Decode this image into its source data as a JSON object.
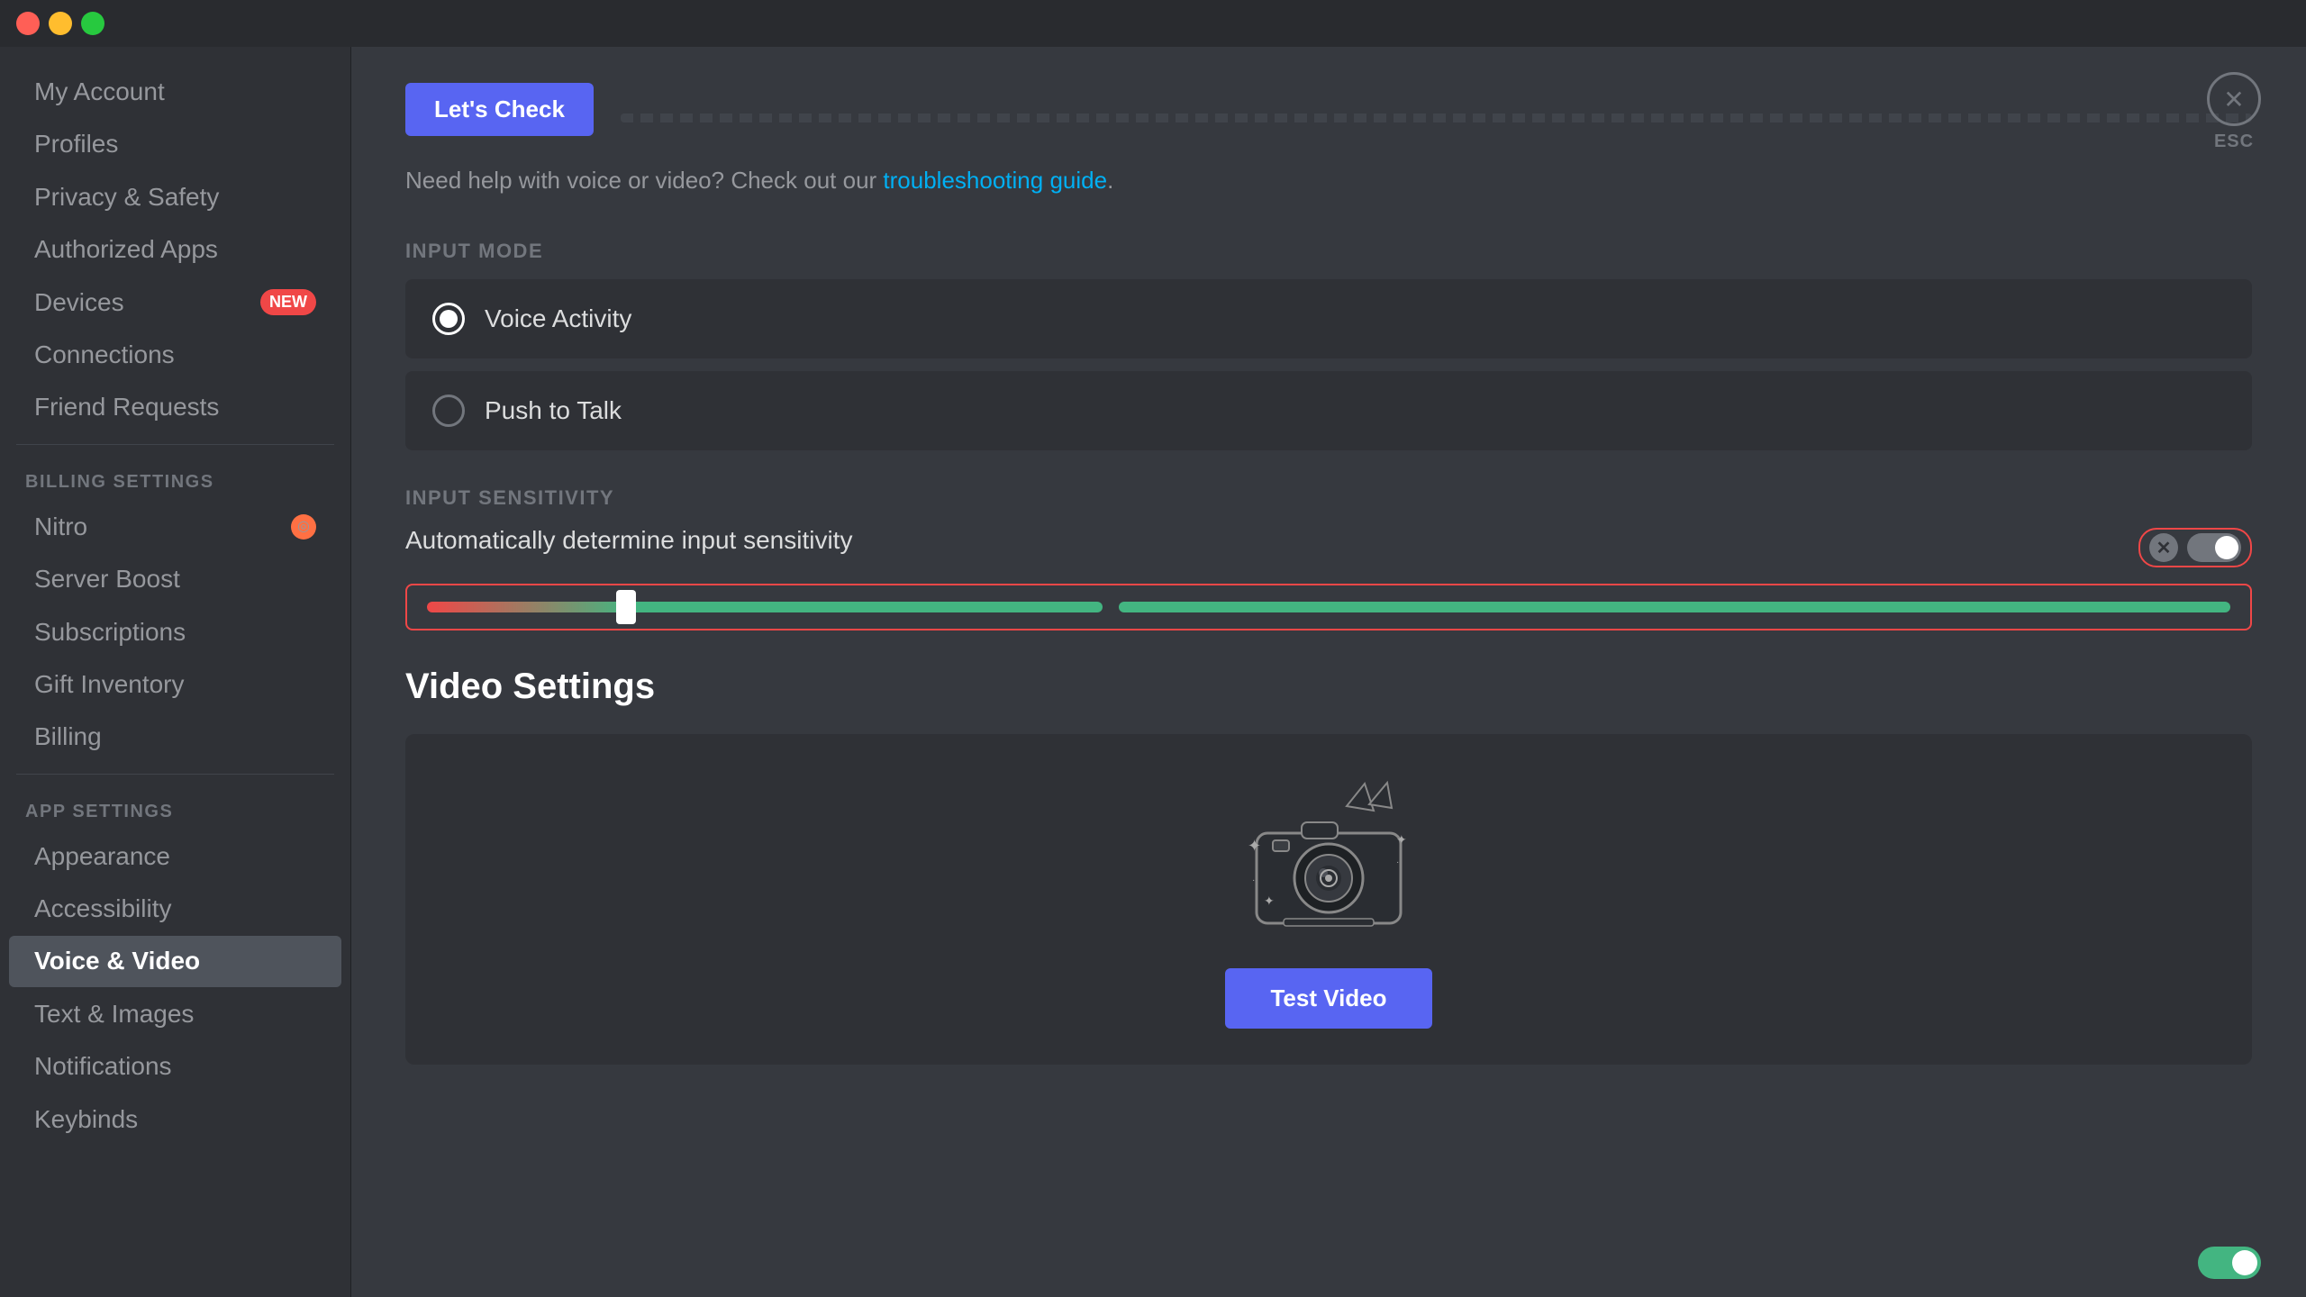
{
  "titlebar": {
    "traffic_lights": [
      "red",
      "yellow",
      "green"
    ]
  },
  "sidebar": {
    "items": [
      {
        "id": "my-account",
        "label": "My Account",
        "active": false,
        "section": null
      },
      {
        "id": "profiles",
        "label": "Profiles",
        "active": false,
        "section": null
      },
      {
        "id": "privacy-safety",
        "label": "Privacy & Safety",
        "active": false,
        "section": null
      },
      {
        "id": "authorized-apps",
        "label": "Authorized Apps",
        "active": false,
        "section": null
      },
      {
        "id": "devices",
        "label": "Devices",
        "active": false,
        "badge": "NEW",
        "section": null
      },
      {
        "id": "connections",
        "label": "Connections",
        "active": false,
        "section": null
      },
      {
        "id": "friend-requests",
        "label": "Friend Requests",
        "active": false,
        "section": null
      },
      {
        "id": "billing-settings",
        "label": "BILLING SETTINGS",
        "type": "section"
      },
      {
        "id": "nitro",
        "label": "Nitro",
        "active": false,
        "hasNitroIcon": true,
        "section": "billing"
      },
      {
        "id": "server-boost",
        "label": "Server Boost",
        "active": false,
        "section": "billing"
      },
      {
        "id": "subscriptions",
        "label": "Subscriptions",
        "active": false,
        "section": "billing"
      },
      {
        "id": "gift-inventory",
        "label": "Gift Inventory",
        "active": false,
        "section": "billing"
      },
      {
        "id": "billing",
        "label": "Billing",
        "active": false,
        "section": "billing"
      },
      {
        "id": "app-settings",
        "label": "APP SETTINGS",
        "type": "section"
      },
      {
        "id": "appearance",
        "label": "Appearance",
        "active": false,
        "section": "app"
      },
      {
        "id": "accessibility",
        "label": "Accessibility",
        "active": false,
        "section": "app"
      },
      {
        "id": "voice-video",
        "label": "Voice & Video",
        "active": true,
        "section": "app"
      },
      {
        "id": "text-images",
        "label": "Text & Images",
        "active": false,
        "section": "app"
      },
      {
        "id": "notifications",
        "label": "Notifications",
        "active": false,
        "section": "app"
      },
      {
        "id": "keybinds",
        "label": "Keybinds",
        "active": false,
        "section": "app"
      }
    ]
  },
  "content": {
    "lets_check_label": "Let's Check",
    "help_text": "Need help with voice or video? Check out our ",
    "help_link": "troubleshooting guide",
    "help_suffix": ".",
    "input_mode_label": "INPUT MODE",
    "voice_activity_label": "Voice Activity",
    "push_to_talk_label": "Push to Talk",
    "input_sensitivity_label": "INPUT SENSITIVITY",
    "auto_sensitivity_label": "Automatically determine input sensitivity",
    "video_settings_title": "Video Settings",
    "test_video_label": "Test Video",
    "esc_label": "ESC"
  }
}
